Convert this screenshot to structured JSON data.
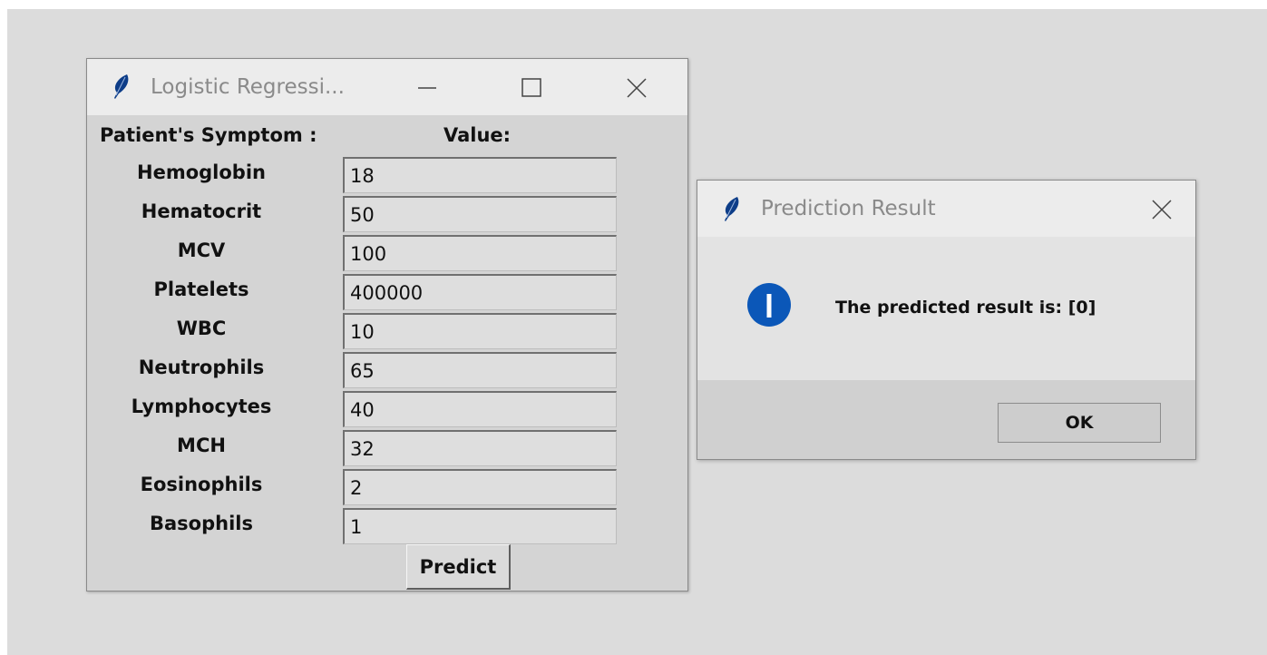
{
  "main_window": {
    "title": "Logistic Regressi...",
    "header": {
      "symptom_label": "Patient's Symptom :",
      "value_label": "Value:"
    },
    "fields": [
      {
        "label": "Hemoglobin",
        "value": "18"
      },
      {
        "label": "Hematocrit",
        "value": "50"
      },
      {
        "label": "MCV",
        "value": "100"
      },
      {
        "label": "Platelets",
        "value": "400000"
      },
      {
        "label": "WBC",
        "value": "10"
      },
      {
        "label": "Neutrophils",
        "value": "65"
      },
      {
        "label": "Lymphocytes",
        "value": "40"
      },
      {
        "label": "MCH",
        "value": "32"
      },
      {
        "label": "Eosinophils",
        "value": "2"
      },
      {
        "label": "Basophils",
        "value": "1"
      }
    ],
    "predict_label": "Predict"
  },
  "dialog": {
    "title": "Prediction Result",
    "message": "The predicted result is: [0]",
    "ok_label": "OK"
  },
  "icons": {
    "app": "feather-icon",
    "minimize": "minimize-icon",
    "maximize": "maximize-icon",
    "close": "close-icon",
    "info": "info-icon"
  },
  "colors": {
    "info_blue": "#0b57b8",
    "feather": "#0d3d88"
  }
}
